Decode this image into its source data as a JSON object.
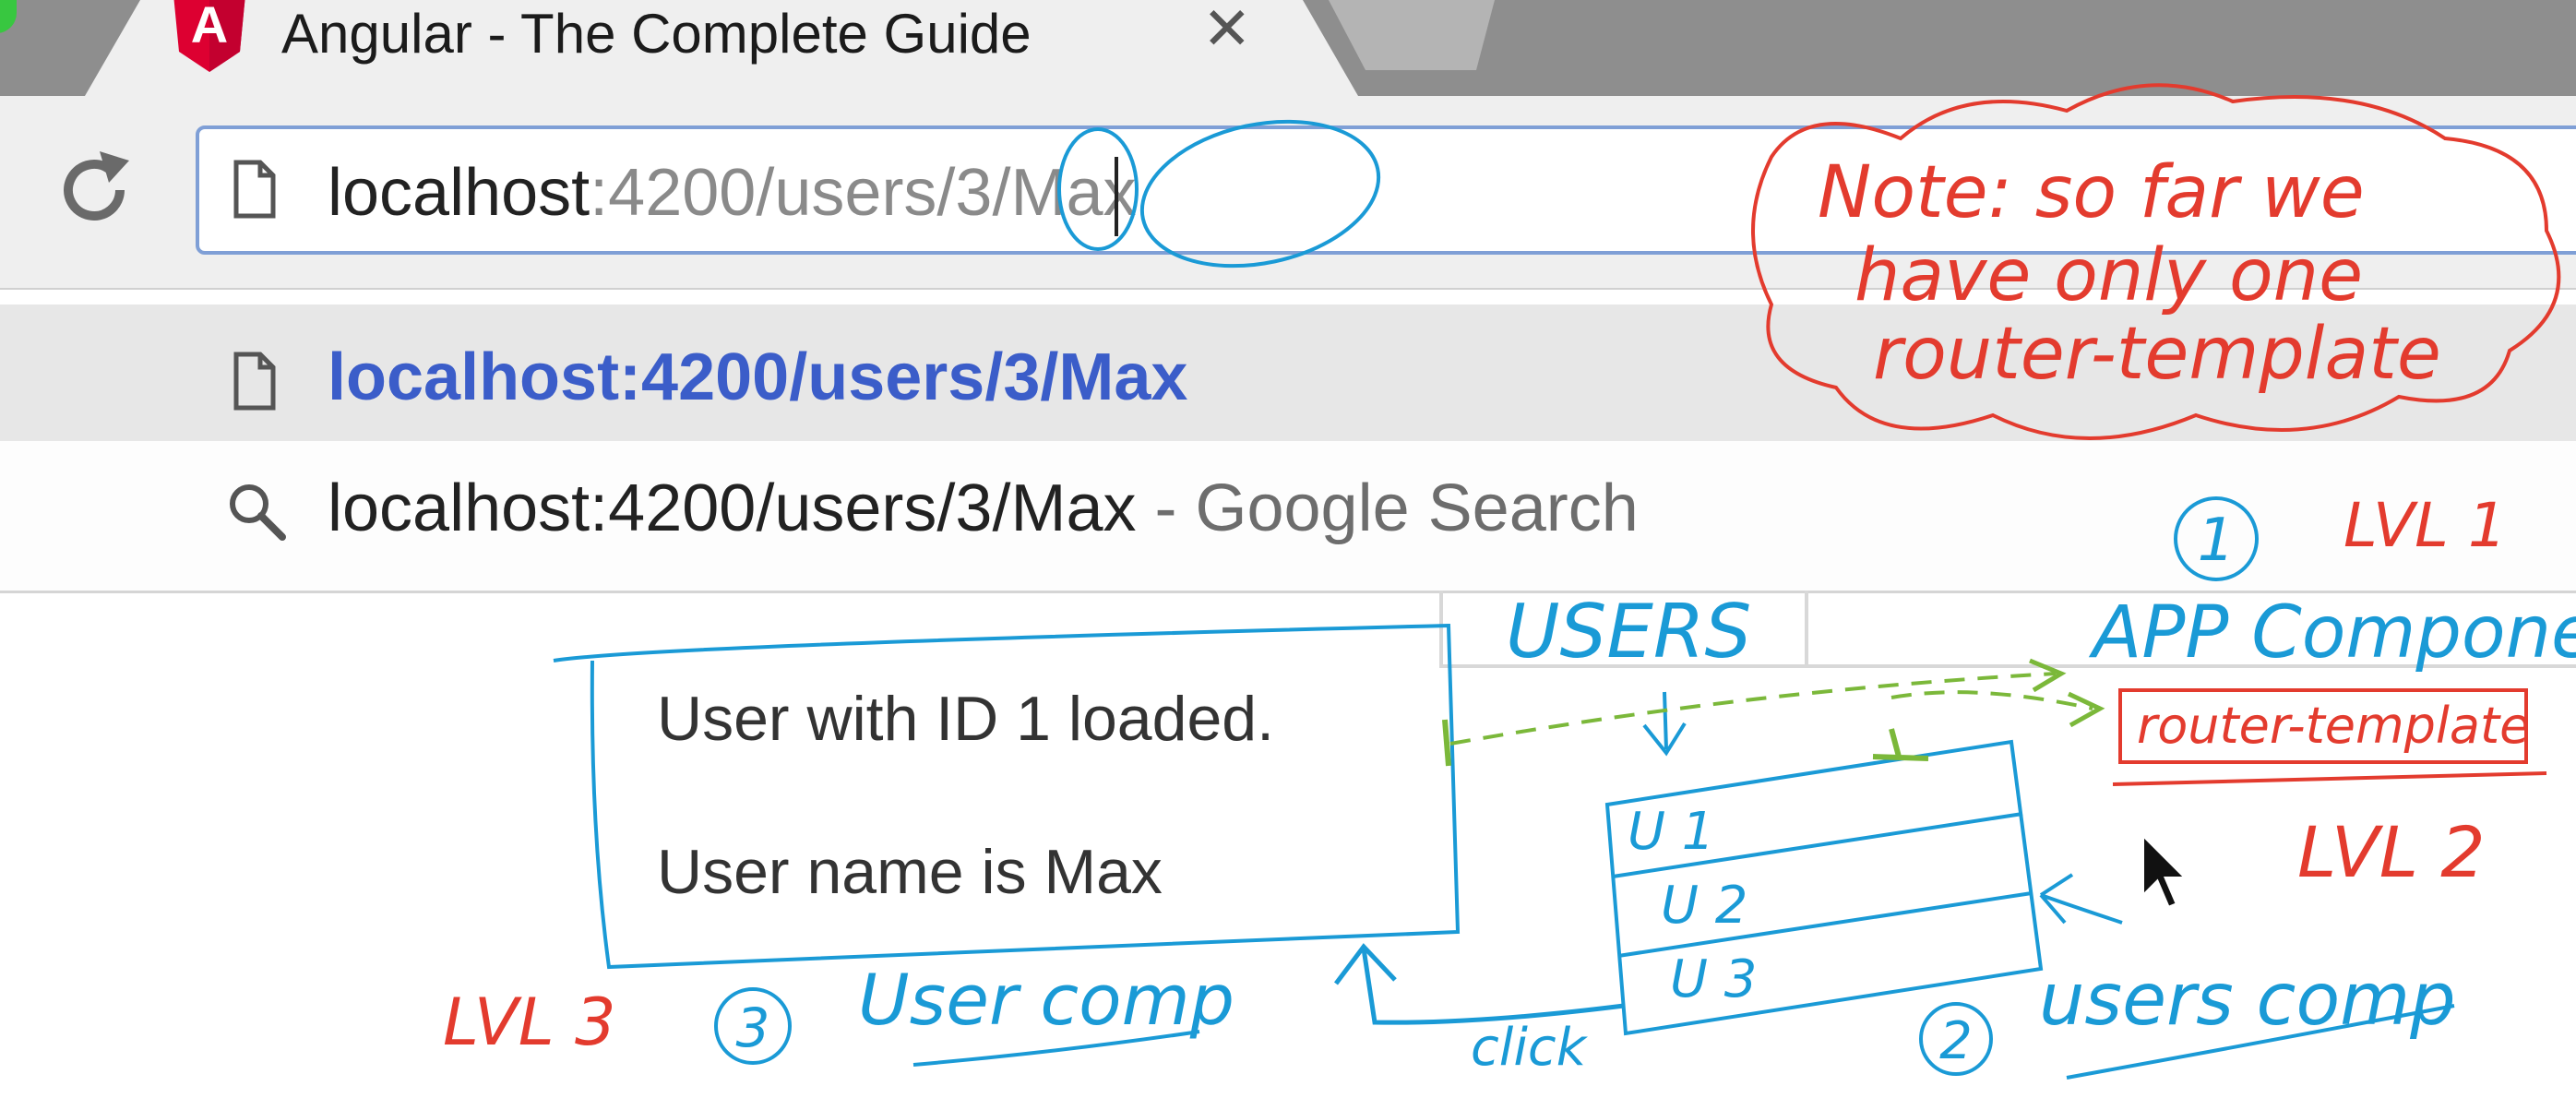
{
  "browser": {
    "tab": {
      "title": "Angular - The Complete Guide",
      "close_glyph": "✕",
      "favicon": "A"
    },
    "address_bar": {
      "host": "localhost",
      "rest": ":4200/users/3/Max"
    },
    "suggestions": [
      {
        "icon": "page-icon",
        "text": "localhost:4200/users/3/Max"
      },
      {
        "icon": "search-icon",
        "text": "localhost:4200/users/3/Max",
        "suffix": " - Google Search"
      }
    ]
  },
  "page": {
    "user_id_text": "User with ID 1 loaded.",
    "user_name_text": "User name is Max"
  },
  "annotations": {
    "note": [
      "Note: so far we",
      "have only one",
      "router-template"
    ],
    "app": {
      "number": "1",
      "level": "LVL 1",
      "label": "APP Component",
      "box": "router-template"
    },
    "users": {
      "heading": "USERS",
      "number": "2",
      "level": "LVL 2",
      "label": "users comp",
      "rows": [
        "U 1",
        "U 2",
        "U 3"
      ],
      "click": "click"
    },
    "user": {
      "number": "3",
      "level": "LVL 3",
      "label": "User comp"
    }
  },
  "colors": {
    "red_ink": "#e33b2e",
    "blue_ink": "#1a9ad6",
    "green_ink": "#7bb83a",
    "omnibox_border": "#7f9fd6",
    "suggestion_blue": "#3b5dc9"
  }
}
